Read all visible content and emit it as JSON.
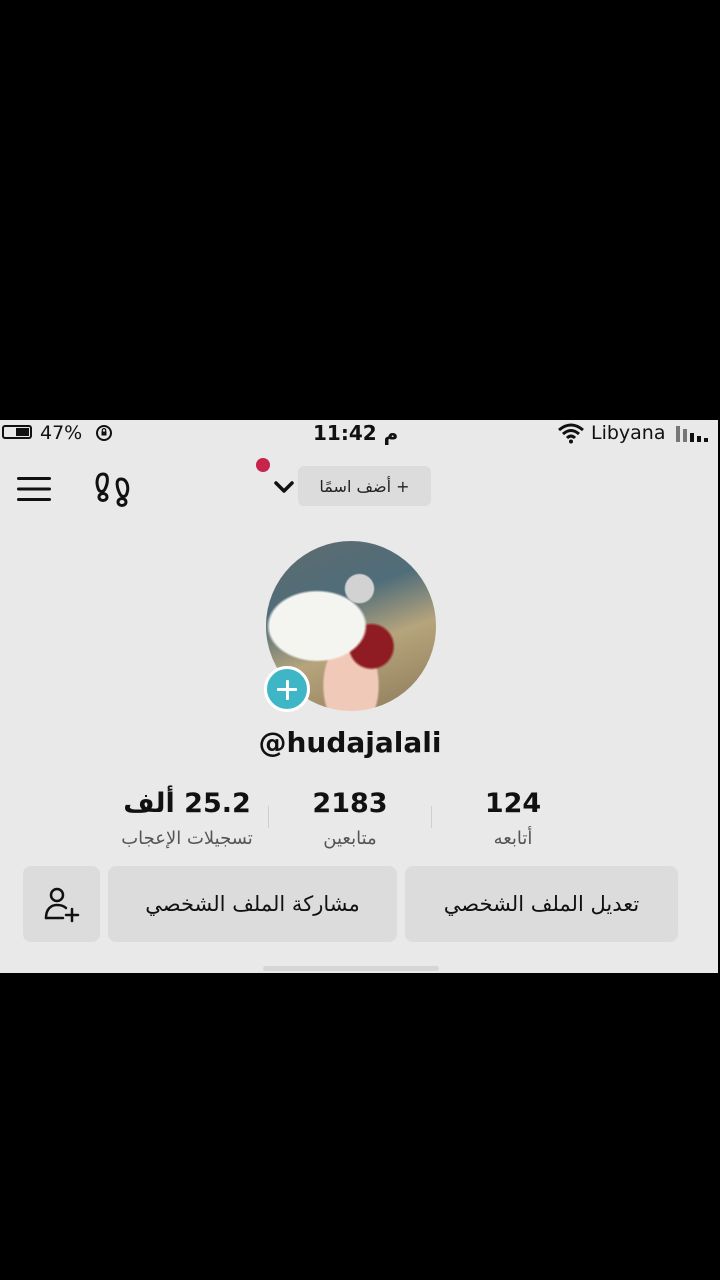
{
  "status_bar": {
    "battery_percent": "47%",
    "battery_level": 0.47,
    "time": "11:42 م",
    "carrier": "Libyana",
    "icons": [
      "battery-icon",
      "rotation-lock-icon",
      "wifi-icon",
      "signal-icon"
    ]
  },
  "top_bar": {
    "add_name_label": "+ أضف اسمًا",
    "icons": [
      "menu-icon",
      "footprints-icon",
      "chevron-down-icon"
    ],
    "notification_color": "#c8234b"
  },
  "profile": {
    "username": "@hudajalali",
    "avatar_add_color": "#3fb6c5"
  },
  "stats": [
    {
      "value": "124",
      "label": "أتابعه"
    },
    {
      "value": "2183",
      "label": "متابعين"
    },
    {
      "value": "25.2 ألف",
      "label": "تسجيلات الإعجاب"
    }
  ],
  "buttons": {
    "edit_profile": "تعديل الملف الشخصي",
    "share_profile": "مشاركة الملف الشخصي",
    "add_friend_icon": "add-friend-icon"
  }
}
